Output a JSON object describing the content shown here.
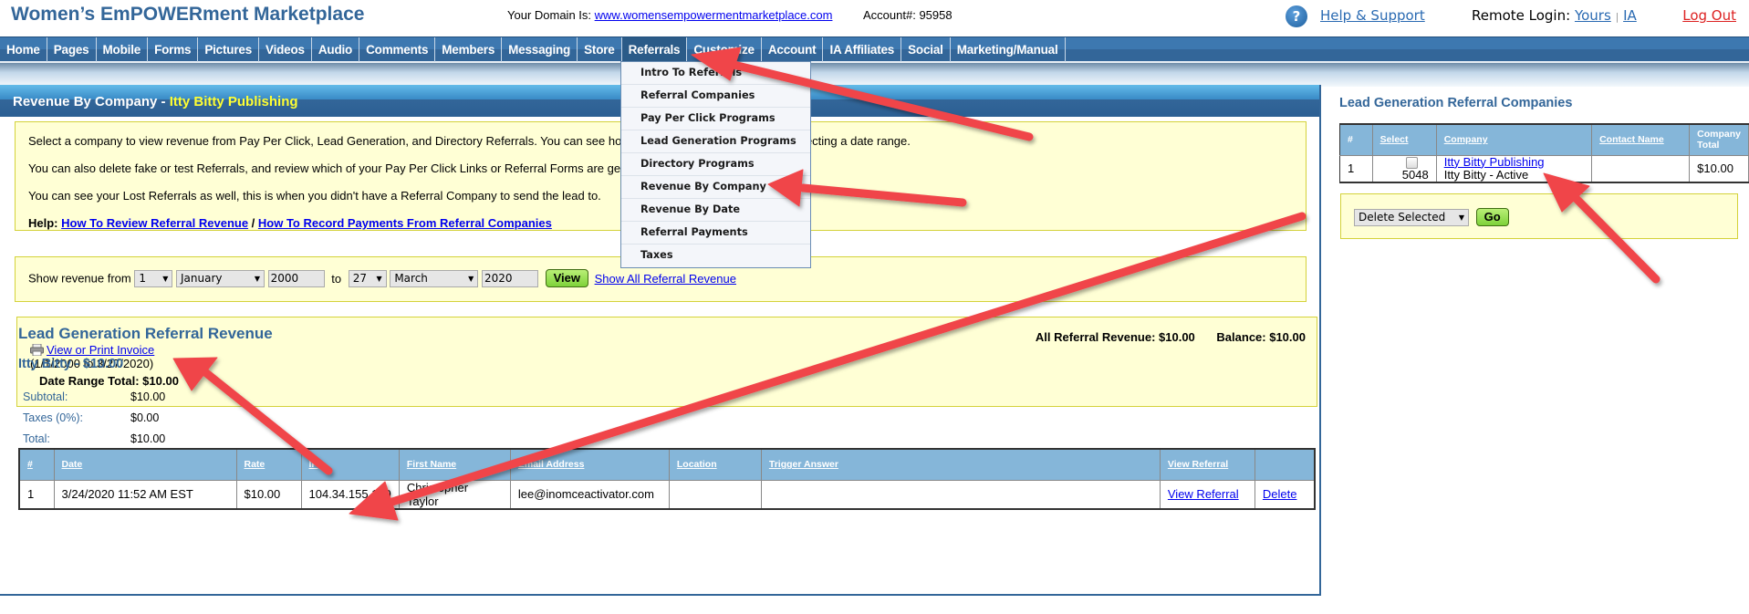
{
  "header": {
    "site_title": "Women’s EmPOWERment Marketplace",
    "domain_label": "Your Domain Is:",
    "domain_link": "www.womensempowermentmarketplace.com",
    "account_label": "Account#:",
    "account_number": "95958",
    "help_icon": "question-circle-icon",
    "help_label": "Help & Support",
    "remote_login_label": "Remote Login:",
    "remote_login_yours": "Yours",
    "remote_login_sep": "|",
    "remote_login_ia": "IA",
    "logout_label": "Log Out"
  },
  "nav": {
    "items": [
      "Home",
      "Pages",
      "Mobile",
      "Forms",
      "Pictures",
      "Videos",
      "Audio",
      "Comments",
      "Members",
      "Messaging",
      "Store",
      "Referrals",
      "Customize",
      "Account",
      "IA Affiliates",
      "Social",
      "Marketing/Manual"
    ],
    "active": "Referrals",
    "dropdown": [
      "Intro To Referrals",
      "Referral Companies",
      "Pay Per Click Programs",
      "Lead Generation Programs",
      "Directory Programs",
      "Revenue By Company",
      "Revenue By Date",
      "Referral Payments",
      "Taxes"
    ]
  },
  "page": {
    "title_prefix": "Revenue By Company - ",
    "title_company": "Itty Bitty Publishing",
    "intro": [
      "Select a company to view revenue from Pay Per Click, Lead Generation, and Directory Referrals. You can see how much revenue you earned by selecting a date range.",
      "You can also delete fake or test Referrals, and review which of your Pay Per Click Links or Referral Forms are generating referrals.",
      "You can see your Lost Referrals as well, this is when you didn't have a Referral Company to send the lead to."
    ],
    "help_label": "Help:",
    "help_link_1": "How To Review Referral Revenue",
    "help_sep": " / ",
    "help_link_2": "How To Record Payments From Referral Companies"
  },
  "range": {
    "label_from": "Show revenue from",
    "from_day": "1",
    "from_month": "January",
    "from_year": "2000",
    "label_to": "to",
    "to_day": "27",
    "to_month": "March",
    "to_year": "2020",
    "view_button": "View",
    "show_all_link": "Show All Referral Revenue"
  },
  "invoice": {
    "printer_icon": "printer-icon",
    "link": "View or Print Invoice",
    "range": "(1/1/2000 to 3/27/2020)",
    "date_range_total": "Date Range Total: $10.00",
    "all_referral_revenue": "All Referral Revenue: $10.00",
    "balance": "Balance: $10.00"
  },
  "lead_revenue": {
    "heading": "Lead Generation Referral Revenue",
    "company_heading": "Itty Bitty - $10.00",
    "totals": [
      {
        "label": "Subtotal:",
        "value": "$10.00"
      },
      {
        "label": "Taxes (0%):",
        "value": "$0.00"
      },
      {
        "label": "Total:",
        "value": "$10.00"
      }
    ],
    "columns": [
      "#",
      "Date",
      "Rate",
      "IP",
      "First Name",
      "Email Address",
      "Location",
      "Trigger Answer",
      "View Referral",
      ""
    ],
    "rows": [
      {
        "num": "1",
        "date": "3/24/2020 11:52 AM EST",
        "rate": "$10.00",
        "ip": "104.34.155.109",
        "first_name": "Christopher Taylor",
        "email": "lee@inomceactivator.com",
        "location": "",
        "trigger_answer": "",
        "view_referral": "View Referral",
        "delete": "Delete"
      }
    ]
  },
  "companies": {
    "heading": "Lead Generation Referral Companies",
    "columns": [
      "#",
      "Select",
      "Company",
      "Contact Name",
      "Company Total"
    ],
    "rows": [
      {
        "num": "1",
        "id": "5048",
        "checked": false,
        "company": "Itty Bitty Publishing",
        "status": "Itty Bitty - Active",
        "contact": "",
        "total": "$10.00"
      }
    ],
    "bulk_action": "Delete Selected",
    "go_button": "Go"
  },
  "colors": {
    "brand_blue": "#336699",
    "highlight_yellow": "#ffff33",
    "panel_yellow": "#ffffd5",
    "table_header": "#85b6d9",
    "logout_red": "#dd2222",
    "annotation_arrow": "#f0454a"
  }
}
